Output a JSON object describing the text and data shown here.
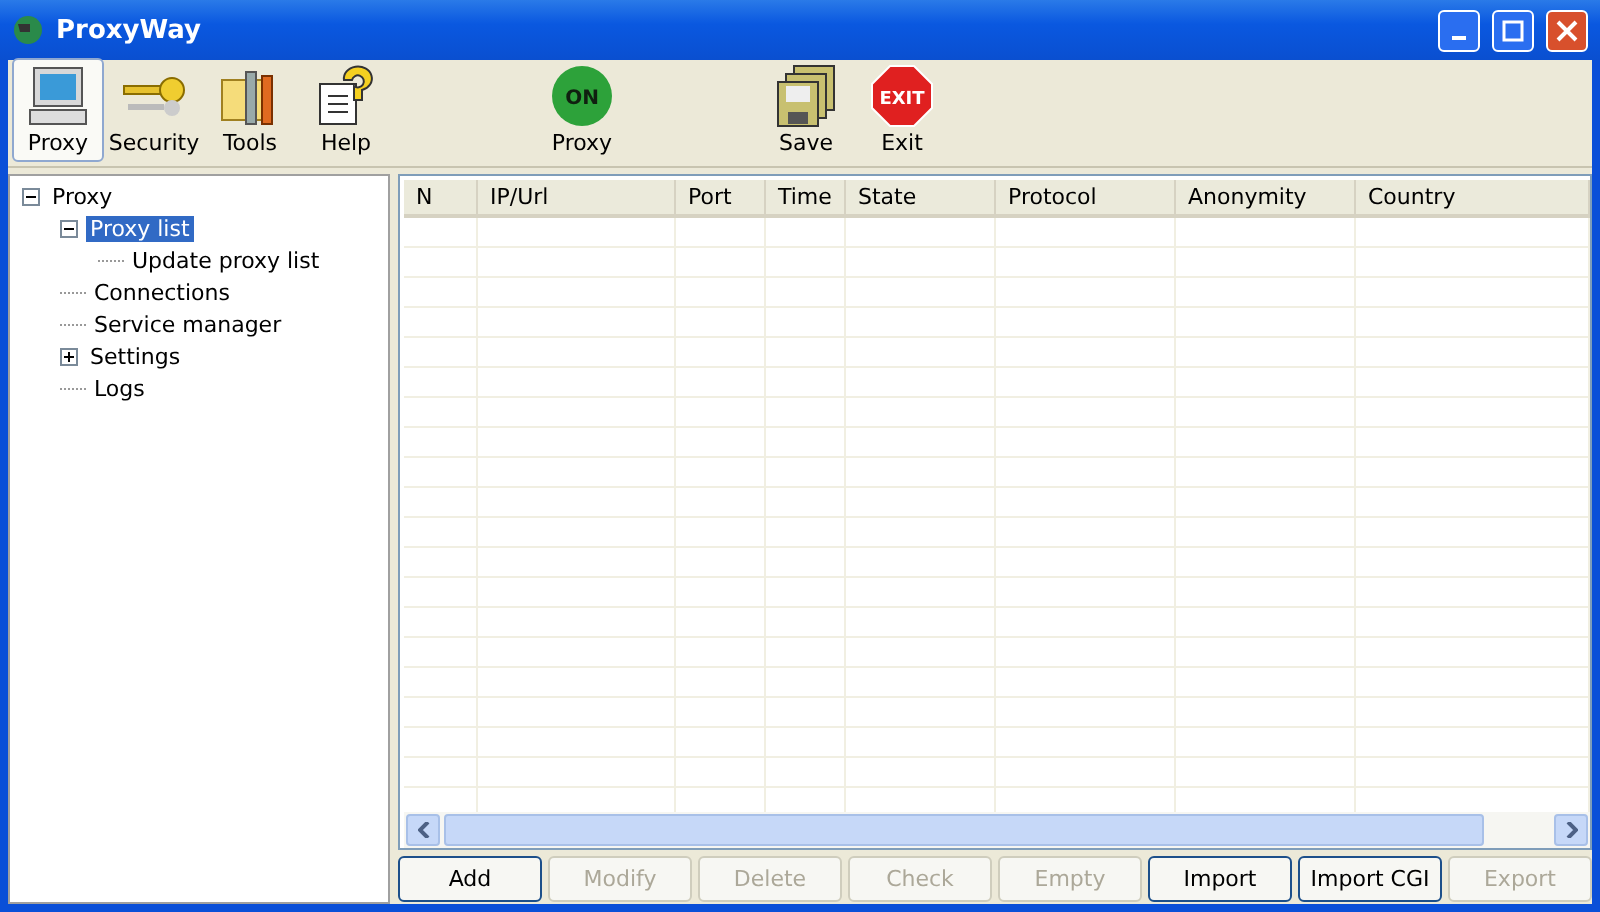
{
  "window": {
    "title": "ProxyWay"
  },
  "toolbar": [
    {
      "label": "Proxy",
      "kind": "monitor",
      "selected": true
    },
    {
      "label": "Security",
      "kind": "key",
      "selected": false
    },
    {
      "label": "Tools",
      "kind": "tools",
      "selected": false
    },
    {
      "label": "Help",
      "kind": "help",
      "selected": false
    },
    {
      "label": "Proxy",
      "kind": "on",
      "selected": false,
      "badge": "ON"
    },
    {
      "label": "Save",
      "kind": "save",
      "selected": false
    },
    {
      "label": "Exit",
      "kind": "exit",
      "selected": false,
      "badge": "EXIT"
    }
  ],
  "tree": [
    {
      "label": "Proxy",
      "selected": false,
      "expanded": true,
      "children": [
        {
          "label": "Proxy list",
          "selected": true,
          "expanded": true,
          "children": [
            {
              "label": "Update proxy list",
              "selected": false
            }
          ]
        },
        {
          "label": "Connections",
          "selected": false
        },
        {
          "label": "Service manager",
          "selected": false
        },
        {
          "label": "Settings",
          "selected": false,
          "expanded": false
        },
        {
          "label": "Logs",
          "selected": false
        }
      ]
    }
  ],
  "table": {
    "columns": [
      "N",
      "IP/Url",
      "Port",
      "Time",
      "State",
      "Protocol",
      "Anonymity",
      "Country"
    ]
  },
  "buttons": [
    {
      "label": "Add",
      "disabled": false
    },
    {
      "label": "Modify",
      "disabled": true
    },
    {
      "label": "Delete",
      "disabled": true
    },
    {
      "label": "Check",
      "disabled": true
    },
    {
      "label": "Empty",
      "disabled": true
    },
    {
      "label": "Import",
      "disabled": false
    },
    {
      "label": "Import CGI",
      "disabled": false
    },
    {
      "label": "Export",
      "disabled": true
    }
  ]
}
